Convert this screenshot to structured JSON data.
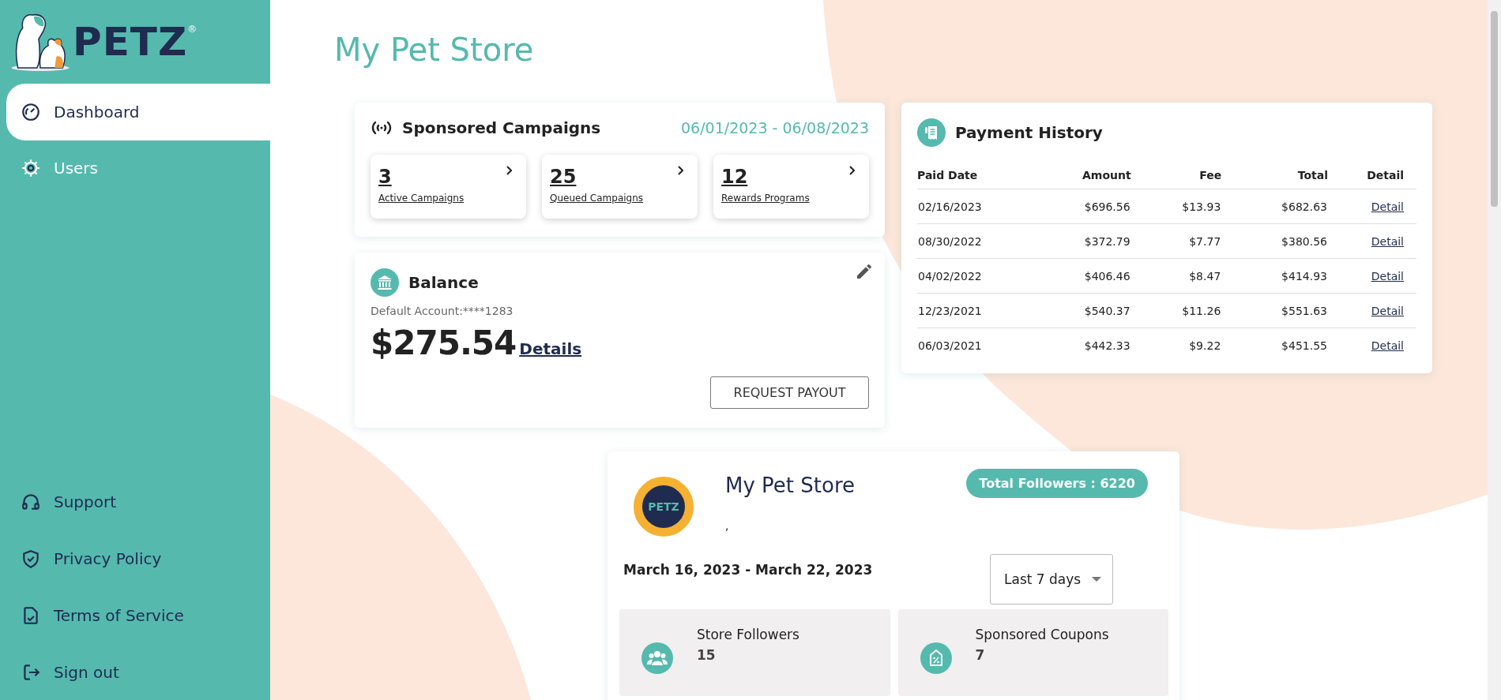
{
  "brand": {
    "name": "PETZ",
    "mark": "®"
  },
  "nav": [
    {
      "label": "Dashboard",
      "kind": "gauge",
      "selected": true
    },
    {
      "label": "Users",
      "kind": "gear",
      "selected": false
    }
  ],
  "nav_bottom": [
    {
      "label": "Support",
      "kind": "headset"
    },
    {
      "label": "Privacy Policy",
      "kind": "shield"
    },
    {
      "label": "Terms of Service",
      "kind": "document"
    },
    {
      "label": "Sign out",
      "kind": "signout"
    }
  ],
  "page_title": "My Pet Store",
  "sponsored": {
    "title": "Sponsored Campaigns",
    "date_range": "06/01/2023 - 06/08/2023",
    "tiles": [
      {
        "value": "3",
        "label": "Active Campaigns"
      },
      {
        "value": "25",
        "label": "Queued Campaigns"
      },
      {
        "value": "12",
        "label": "Rewards Programs"
      }
    ]
  },
  "balance": {
    "title": "Balance",
    "account": "Default Account:****1283",
    "amount": "$275.54",
    "details_link": "Details",
    "button": "REQUEST PAYOUT"
  },
  "payments": {
    "title": "Payment History",
    "columns": [
      "Paid Date",
      "Amount",
      "Fee",
      "Total",
      "Detail"
    ],
    "rows": [
      {
        "date": "02/16/2023",
        "amount": "$696.56",
        "fee": "$13.93",
        "total": "$682.63",
        "link": "Detail"
      },
      {
        "date": "08/30/2022",
        "amount": "$372.79",
        "fee": "$7.77",
        "total": "$380.56",
        "link": "Detail"
      },
      {
        "date": "04/02/2022",
        "amount": "$406.46",
        "fee": "$8.47",
        "total": "$414.93",
        "link": "Detail"
      },
      {
        "date": "12/23/2021",
        "amount": "$540.37",
        "fee": "$11.26",
        "total": "$551.63",
        "link": "Detail"
      },
      {
        "date": "06/03/2021",
        "amount": "$442.33",
        "fee": "$9.22",
        "total": "$451.55",
        "link": "Detail"
      }
    ]
  },
  "store": {
    "badge": {
      "center": "PETZ"
    },
    "name": "My Pet Store",
    "followers_badge": "Total Followers : 6220",
    "subtitle": ",",
    "date_range": "March 16, 2023 - March 22, 2023",
    "period": "Last 7 days",
    "stats": [
      {
        "label": "Store Followers",
        "value": "15",
        "kind": "people"
      },
      {
        "label": "Sponsored Coupons",
        "value": "7",
        "kind": "coupon"
      }
    ]
  }
}
